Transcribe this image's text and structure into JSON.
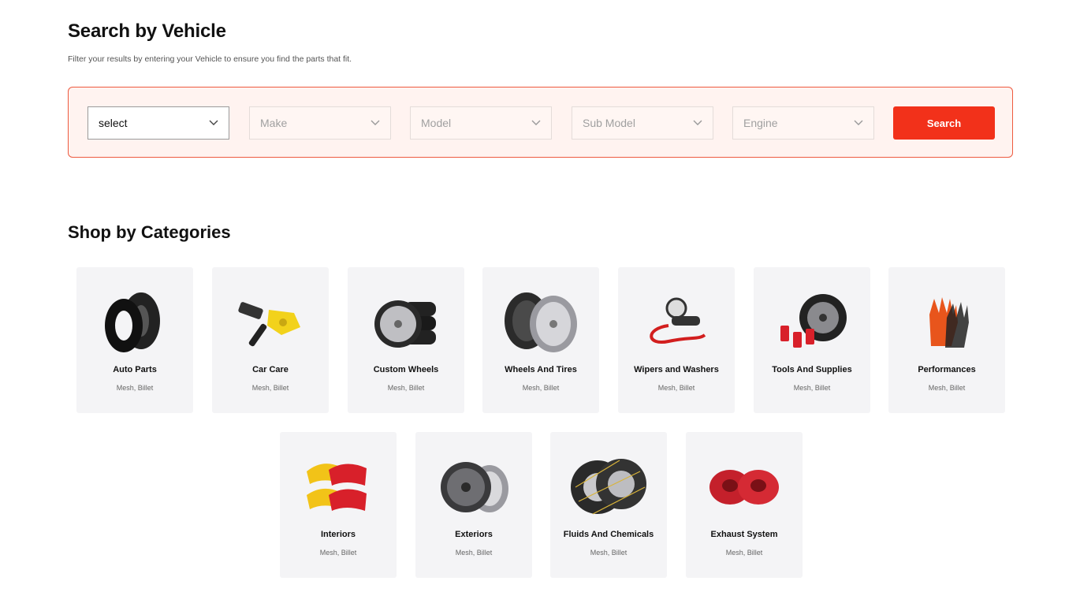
{
  "vehicle_search": {
    "title": "Search by Vehicle",
    "subtitle": "Filter your results by entering your Vehicle to ensure you find the parts that fit.",
    "selects": [
      {
        "value": "select"
      },
      {
        "placeholder": "Make"
      },
      {
        "placeholder": "Model"
      },
      {
        "placeholder": "Sub Model"
      },
      {
        "placeholder": "Engine"
      }
    ],
    "search_label": "Search",
    "accent_color": "#f2311a",
    "panel_bg": "#fff3f0"
  },
  "categories": {
    "title": "Shop by Categories",
    "items": [
      {
        "name": "Auto Parts",
        "sub": "Mesh, Billet",
        "icon": "tires-icon"
      },
      {
        "name": "Car Care",
        "sub": "Mesh, Billet",
        "icon": "tpms-sensor-icon"
      },
      {
        "name": "Custom Wheels",
        "sub": "Mesh, Billet",
        "icon": "wheel-stack-icon"
      },
      {
        "name": "Wheels And Tires",
        "sub": "Mesh, Billet",
        "icon": "alloy-wheels-icon"
      },
      {
        "name": "Wipers and Washers",
        "sub": "Mesh, Billet",
        "icon": "tire-inflator-icon"
      },
      {
        "name": "Tools And Supplies",
        "sub": "Mesh, Billet",
        "icon": "lug-nuts-icon"
      },
      {
        "name": "Performances",
        "sub": "Mesh, Billet",
        "icon": "gloves-icon"
      },
      {
        "name": "Interiors",
        "sub": "Mesh, Billet",
        "icon": "brake-caliper-covers-icon"
      },
      {
        "name": "Exteriors",
        "sub": "Mesh, Billet",
        "icon": "rims-icon"
      },
      {
        "name": "Fluids And Chemicals",
        "sub": "Mesh, Billet",
        "icon": "snow-chains-icon"
      },
      {
        "name": "Exhaust System",
        "sub": "Mesh, Billet",
        "icon": "wheel-spacers-icon"
      }
    ]
  }
}
